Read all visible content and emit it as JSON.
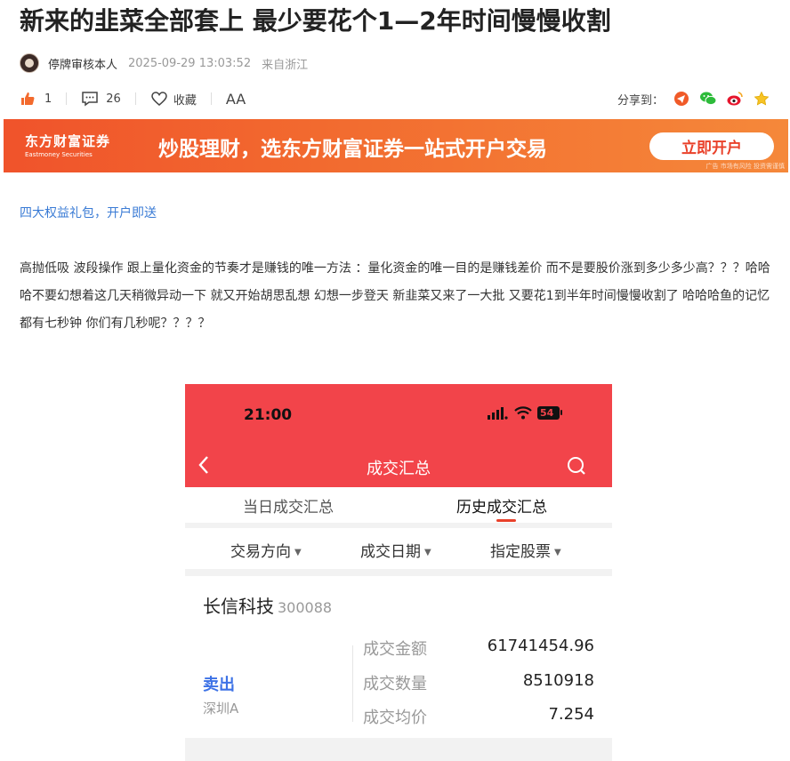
{
  "article": {
    "title": "新来的韭菜全部套上 最少要花个1—2年时间慢慢收割",
    "author": "停牌审核本人",
    "time": "2025-09-29 13:03:52",
    "source": "来自浙江",
    "likes": "1",
    "comments": "26",
    "favorite_label": "收藏",
    "font_label": "AA",
    "share_label": "分享到："
  },
  "banner": {
    "logo_cn": "东方财富证券",
    "logo_en": "Eastmoney Securities",
    "text": "炒股理财，选东方财富证券一站式开户交易",
    "button": "立即开户",
    "ad_note": "广告 市场有风险 投资需谨慎"
  },
  "body": {
    "promo_link": "四大权益礼包，开户即送",
    "paragraph": "高抛低吸 波段操作 跟上量化资金的节奏才是赚钱的唯一方法 ：量化资金的唯一目的是赚钱差价 而不是要股价涨到多少多少高？？？哈哈哈不要幻想着这几天稍微异动一下  就又开始胡思乱想 幻想一步登天 新韭菜又来了一大批 又要花1到半年时间慢慢收割了 哈哈哈鱼的记忆都有七秒钟 你们有几秒呢？？？？"
  },
  "screenshot": {
    "time": "21:00",
    "battery": "54",
    "title": "成交汇总",
    "tab_today": "当日成交汇总",
    "tab_history": "历史成交汇总",
    "filter_direction": "交易方向",
    "filter_date": "成交日期",
    "filter_stock": "指定股票",
    "stock_name": "长信科技",
    "stock_code": "300088",
    "side": "卖出",
    "market": "深圳A",
    "amount_label": "成交金额",
    "amount": "61741454.96",
    "qty_label": "成交数量",
    "qty": "8510918",
    "avg_label": "成交均价",
    "avg": "7.254"
  },
  "colors": {
    "accent_red": "#f2444a",
    "link_blue": "#3a7bd5",
    "sell_blue": "#3d72e6",
    "banner_orange": "#f0532b"
  }
}
